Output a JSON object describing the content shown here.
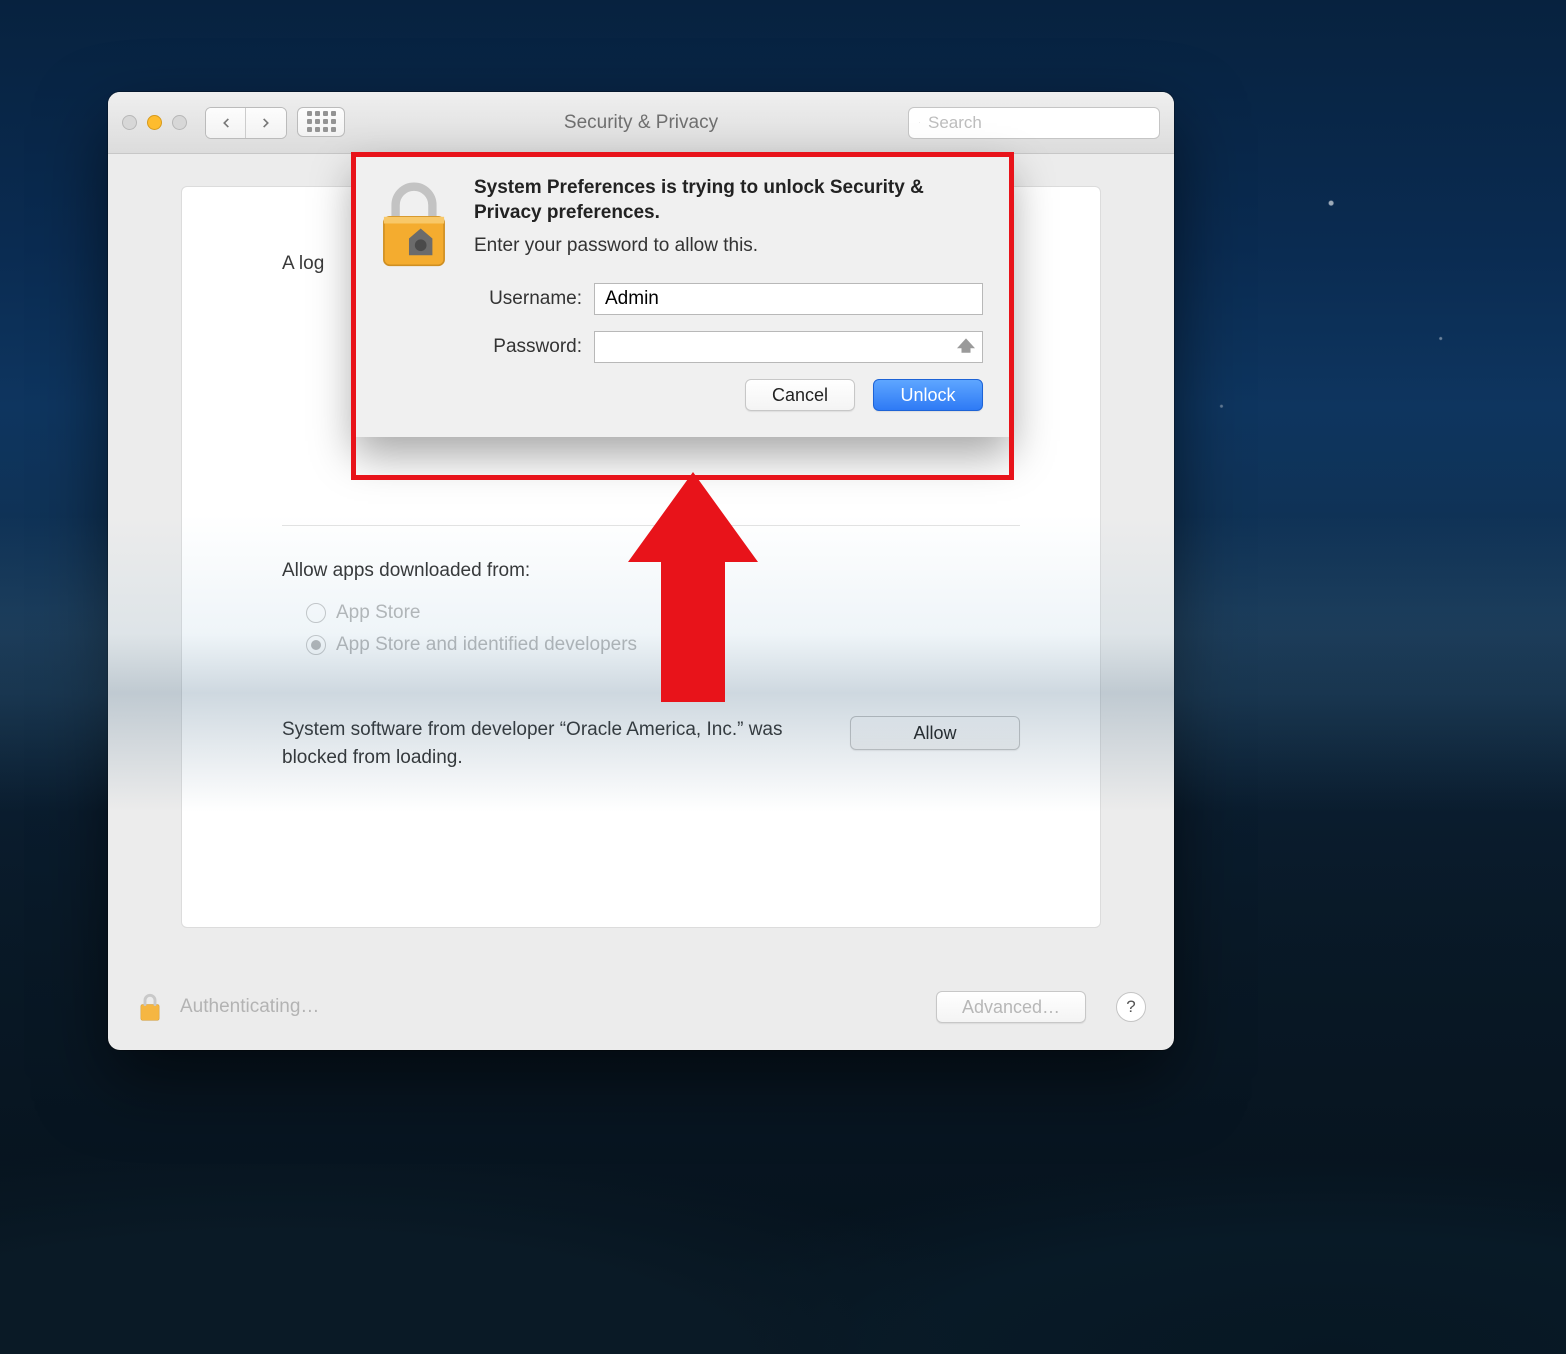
{
  "window": {
    "title": "Security & Privacy",
    "search_placeholder": "Search"
  },
  "panel": {
    "login_fragment": "A log",
    "allow_label": "Allow apps downloaded from:",
    "radio_option_1": "App Store",
    "radio_option_2": "App Store and identified developers",
    "blocked_text": "System software from developer “Oracle America, Inc.” was blocked from loading.",
    "allow_button": "Allow"
  },
  "footer": {
    "status": "Authenticating…",
    "advanced": "Advanced…",
    "help": "?"
  },
  "dialog": {
    "heading": "System Preferences is trying to unlock Security & Privacy preferences.",
    "subheading": "Enter your password to allow this.",
    "username_label": "Username:",
    "password_label": "Password:",
    "username_value": "Admin",
    "password_value": "",
    "cancel": "Cancel",
    "unlock": "Unlock"
  }
}
